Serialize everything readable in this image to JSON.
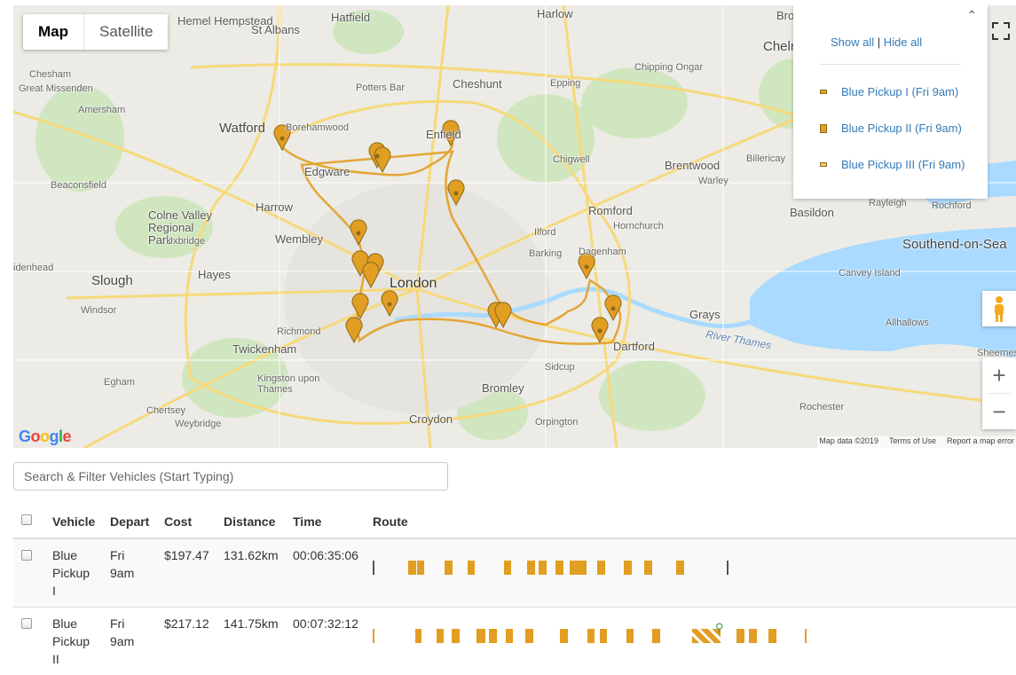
{
  "map": {
    "type_buttons": [
      "Map",
      "Satellite"
    ],
    "active_type": "Map",
    "legend": {
      "show_all": "Show all",
      "separator": "|",
      "hide_all": "Hide all",
      "items": [
        {
          "label": "Blue Pickup I (Fri 9am)",
          "color": "#e29e22"
        },
        {
          "label": "Blue Pickup II (Fri 9am)",
          "color": "#e29e22"
        },
        {
          "label": "Blue Pickup III (Fri 9am)",
          "color": "#f2c96b"
        }
      ]
    },
    "places": {
      "hemel": "Hemel Hempstead",
      "hatfield": "Hatfield",
      "harlow": "Harlow",
      "stalbans": "St Albans",
      "chesham": "Chesham",
      "missenden": "Great Missenden",
      "amersham": "Amersham",
      "potters": "Potters Bar",
      "cheshunt": "Cheshunt",
      "epping": "Epping",
      "chipping": "Chipping Ongar",
      "watford": "Watford",
      "borehamwood": "Borehamwood",
      "enfield": "Enfield",
      "chigwell": "Chigwell",
      "brentwood": "Brentwood",
      "billericay": "Billericay",
      "warley": "Warley",
      "edgware": "Edgware",
      "beaconsfield": "Beaconsfield",
      "colne": "Colne Valley Regional Park",
      "harrow": "Harrow",
      "romford": "Romford",
      "basildon": "Basildon",
      "rayleigh": "Rayleigh",
      "rochford": "Rochford",
      "uxbridge": "Uxbridge",
      "wembley": "Wembley",
      "ilford": "Ilford",
      "hornchurch": "Hornchurch",
      "dagenham": "Dagenham",
      "barking": "Barking",
      "southend": "Southend-on-Sea",
      "slough": "Slough",
      "hayes": "Hayes",
      "london": "London",
      "canvey": "Canvey Island",
      "windsor": "Windsor",
      "richmond": "Richmond",
      "grays": "Grays",
      "allhallows": "Allhallows",
      "twickenham": "Twickenham",
      "thames": "River Thames",
      "dartford": "Dartford",
      "sidcup": "Sidcup",
      "egham": "Egham",
      "kingston": "Kingston upon Thames",
      "bromley": "Bromley",
      "sheerness": "Sheerness",
      "rochester": "Rochester",
      "chertsey": "Chertsey",
      "weybridge": "Weybridge",
      "croydon": "Croydon",
      "orpington": "Orpington",
      "chelmsford": "Chelm",
      "southwoodham": "Broo",
      "slough2": "idenhead"
    },
    "logo": "Google",
    "attribution": [
      "Map data ©2019",
      "Terms of Use",
      "Report a map error"
    ]
  },
  "search": {
    "placeholder": "Search & Filter Vehicles (Start Typing)"
  },
  "table": {
    "headers": [
      "Vehicle",
      "Depart",
      "Cost",
      "Distance",
      "Time",
      "Route"
    ],
    "rows": [
      {
        "vehicle": [
          "Blue",
          "Pickup",
          "I"
        ],
        "depart": [
          "Fri",
          "9am"
        ],
        "cost": "$197.47",
        "distance": "131.62km",
        "time": "00:06:35:06"
      },
      {
        "vehicle": [
          "Blue",
          "Pickup",
          "II"
        ],
        "depart": [
          "Fri",
          "9am"
        ],
        "cost": "$217.12",
        "distance": "141.75km",
        "time": "00:07:32:12"
      }
    ]
  },
  "colors": {
    "route": "#e29e22",
    "link": "#337ab7",
    "water": "#aadaff",
    "park": "#c7e5b3"
  }
}
